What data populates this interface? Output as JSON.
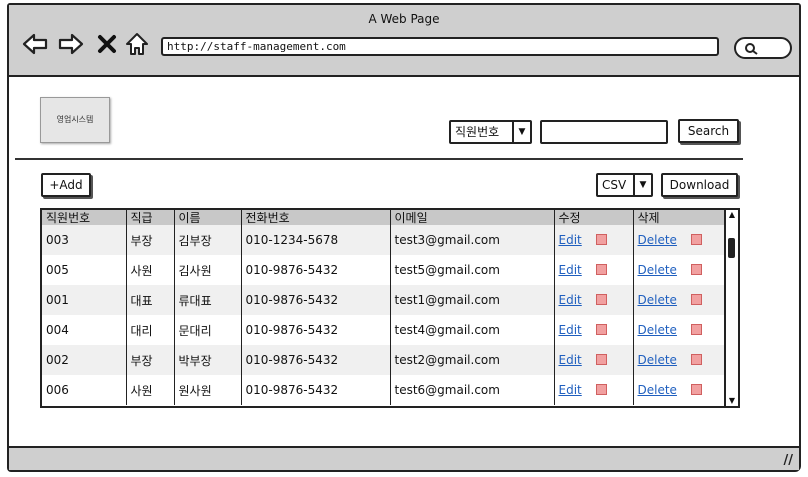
{
  "window": {
    "title": "A Web Page"
  },
  "browser": {
    "url": "http://staff-management.com",
    "nav_icons": [
      "back-arrow-icon",
      "forward-arrow-icon",
      "close-x-icon",
      "home-icon"
    ],
    "search_icon": "search-icon"
  },
  "logo": {
    "text": "영업시스템"
  },
  "search": {
    "field_select": "직원번호",
    "query": "",
    "button": "Search"
  },
  "toolbar": {
    "add_button": "+Add",
    "format_select": "CSV",
    "download_button": "Download"
  },
  "table": {
    "columns": [
      "직원번호",
      "직급",
      "이름",
      "전화번호",
      "이메일",
      "수정",
      "삭제"
    ],
    "rows": [
      {
        "id": "003",
        "rank": "부장",
        "name": "김부장",
        "phone": "010-1234-5678",
        "email": "test3@gmail.com",
        "edit": "Edit",
        "delete": "Delete"
      },
      {
        "id": "005",
        "rank": "사원",
        "name": "김사원",
        "phone": "010-9876-5432",
        "email": "test5@gmail.com",
        "edit": "Edit",
        "delete": "Delete"
      },
      {
        "id": "001",
        "rank": "대표",
        "name": "류대표",
        "phone": "010-9876-5432",
        "email": "test1@gmail.com",
        "edit": "Edit",
        "delete": "Delete"
      },
      {
        "id": "004",
        "rank": "대리",
        "name": "문대리",
        "phone": "010-9876-5432",
        "email": "test4@gmail.com",
        "edit": "Edit",
        "delete": "Delete"
      },
      {
        "id": "002",
        "rank": "부장",
        "name": "박부장",
        "phone": "010-9876-5432",
        "email": "test2@gmail.com",
        "edit": "Edit",
        "delete": "Delete"
      },
      {
        "id": "006",
        "rank": "사원",
        "name": "원사원",
        "phone": "010-9876-5432",
        "email": "test6@gmail.com",
        "edit": "Edit",
        "delete": "Delete"
      }
    ]
  },
  "colors": {
    "link": "#1f5fbf",
    "chrome": "#cfcfcf",
    "header_row": "#c8c8c8"
  }
}
